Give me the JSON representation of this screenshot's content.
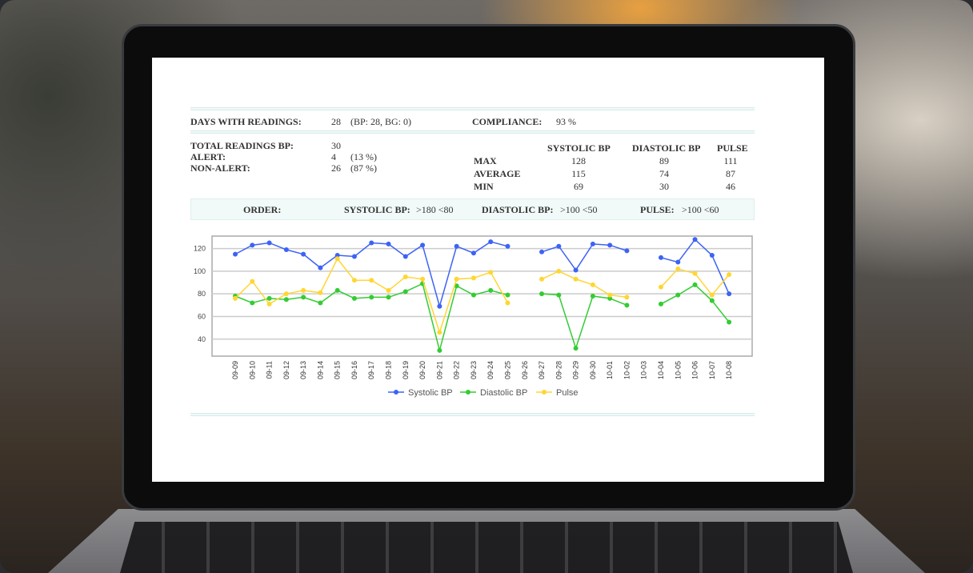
{
  "summary": {
    "days_label": "DAYS WITH READINGS:",
    "days_value": "28",
    "days_detail": "(BP: 28, BG: 0)",
    "compliance_label": "COMPLIANCE:",
    "compliance_value": "93 %",
    "total_label": "TOTAL READINGS BP:",
    "total_value": "30",
    "alert_label": "ALERT:",
    "alert_value": "4",
    "alert_pct": "(13 %)",
    "nonalert_label": "NON-ALERT:",
    "nonalert_value": "26",
    "nonalert_pct": "(87 %)"
  },
  "stats": {
    "headers": [
      "SYSTOLIC BP",
      "DIASTOLIC BP",
      "PULSE"
    ],
    "rows": [
      {
        "label": "MAX",
        "values": [
          "128",
          "89",
          "111"
        ]
      },
      {
        "label": "AVERAGE",
        "values": [
          "115",
          "74",
          "87"
        ]
      },
      {
        "label": "MIN",
        "values": [
          "69",
          "30",
          "46"
        ]
      }
    ]
  },
  "order": {
    "label": "ORDER:",
    "sys_label": "SYSTOLIC BP:",
    "sys_value": ">180 <80",
    "dia_label": "DIASTOLIC BP:",
    "dia_value": ">100 <50",
    "pulse_label": "PULSE:",
    "pulse_value": ">100 <60"
  },
  "chart_data": {
    "type": "line",
    "x": [
      "09-09",
      "09-10",
      "09-11",
      "09-12",
      "09-13",
      "09-14",
      "09-15",
      "09-16",
      "09-17",
      "09-18",
      "09-19",
      "09-20",
      "09-21",
      "09-22",
      "09-23",
      "09-24",
      "09-25",
      "09-26",
      "09-27",
      "09-28",
      "09-29",
      "09-30",
      "10-01",
      "10-02",
      "10-03",
      "10-04",
      "10-05",
      "10-06",
      "10-07",
      "10-08"
    ],
    "yticks": [
      40,
      60,
      80,
      100,
      120
    ],
    "ylim": [
      25,
      131
    ],
    "series": [
      {
        "name": "Systolic BP",
        "color": "#3d63f5",
        "values": [
          115,
          123,
          125,
          119,
          115,
          103,
          114,
          113,
          125,
          124,
          113,
          123,
          69,
          122,
          116,
          126,
          122,
          null,
          117,
          122,
          101,
          124,
          123,
          118,
          null,
          112,
          108,
          128,
          114,
          80
        ]
      },
      {
        "name": "Diastolic BP",
        "color": "#33cc33",
        "values": [
          78,
          72,
          76,
          75,
          77,
          72,
          83,
          76,
          77,
          77,
          82,
          89,
          30,
          87,
          79,
          83,
          79,
          null,
          80,
          79,
          32,
          78,
          76,
          70,
          null,
          71,
          79,
          88,
          74,
          55
        ]
      },
      {
        "name": "Pulse",
        "color": "#ffd633",
        "values": [
          76,
          91,
          71,
          80,
          83,
          81,
          111,
          92,
          92,
          83,
          95,
          93,
          46,
          93,
          94,
          99,
          72,
          null,
          93,
          100,
          93,
          88,
          79,
          77,
          null,
          86,
          102,
          98,
          79,
          97
        ]
      }
    ],
    "legend": "bottom"
  }
}
